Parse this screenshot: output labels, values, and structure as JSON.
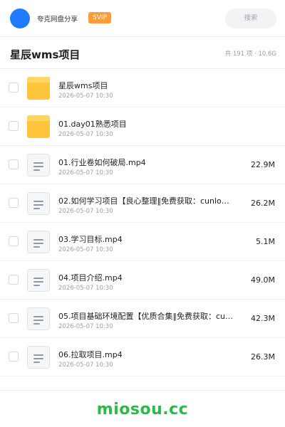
{
  "header": {
    "brand": "夸克网盘分享",
    "badge": "SVIP",
    "search_label": "搜索"
  },
  "titlebar": {
    "title": "星辰wms项目",
    "meta": "共 191 项 · 10.6G"
  },
  "files": [
    {
      "name": "星辰wms项目",
      "date": "2026-05-07 10:30",
      "size": "",
      "icon": "folder-icon"
    },
    {
      "name": "01.day01熟悉项目",
      "date": "2026-05-07 10:30",
      "size": "",
      "icon": "folder-icon"
    },
    {
      "name": "01.行业卷如何破局.mp4",
      "date": "2026-05-07 10:30",
      "size": "22.9M",
      "icon": "file-icon"
    },
    {
      "name": "02.如何学习项目【良心整理‖免费获取：cunlo…",
      "date": "2026-05-07 10:30",
      "size": "26.2M",
      "icon": "file-icon"
    },
    {
      "name": "03.学习目标.mp4",
      "date": "2026-05-07 10:30",
      "size": "5.1M",
      "icon": "file-icon"
    },
    {
      "name": "04.项目介绍.mp4",
      "date": "2026-05-07 10:30",
      "size": "49.0M",
      "icon": "file-icon"
    },
    {
      "name": "05.项目基础环境配置【优质合集‖免费获取：cun…",
      "date": "2026-05-07 10:30",
      "size": "42.3M",
      "icon": "file-icon"
    },
    {
      "name": "06.拉取项目.mp4",
      "date": "2026-05-07 10:30",
      "size": "26.3M",
      "icon": "file-icon"
    }
  ],
  "footer": {
    "watermark": "miosou.cc"
  },
  "colors": {
    "accent": "#1f7bff",
    "badge": "#ff9c38",
    "folder": "#ffc53d",
    "watermark": "#2db84c"
  }
}
